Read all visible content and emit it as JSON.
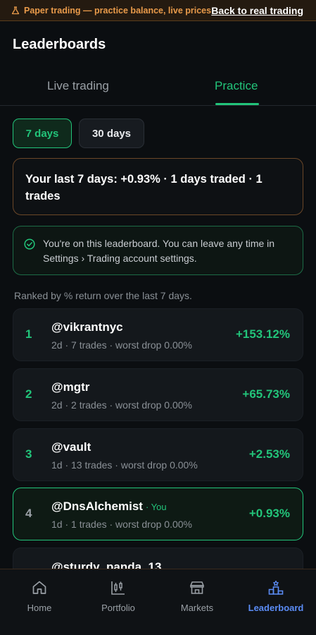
{
  "banner": {
    "text": "Paper trading — practice balance, live prices",
    "link": "Back to real trading"
  },
  "page_title": "Leaderboards",
  "tabs": [
    {
      "label": "Live trading",
      "active": false
    },
    {
      "label": "Practice",
      "active": true
    }
  ],
  "periods": [
    {
      "label": "7 days",
      "active": true
    },
    {
      "label": "30 days",
      "active": false
    }
  ],
  "summary": "Your last 7 days: +0.93% · 1 days traded · 1 trades",
  "notice": "You're on this leaderboard. You can leave any time in Settings › Trading account settings.",
  "ranked_note": "Ranked by % return over the last 7 days.",
  "entries": [
    {
      "rank": "1",
      "name": "@vikrantnyc",
      "meta": "2d · 7 trades · worst drop 0.00%",
      "ret": "+153.12%"
    },
    {
      "rank": "2",
      "name": "@mgtr",
      "meta": "2d · 2 trades · worst drop 0.00%",
      "ret": "+65.73%"
    },
    {
      "rank": "3",
      "name": "@vault",
      "meta": "1d · 13 trades · worst drop 0.00%",
      "ret": "+2.53%"
    },
    {
      "rank": "4",
      "name": "@DnsAlchemist",
      "you_tag": "· You",
      "meta": "1d · 1 trades · worst drop 0.00%",
      "ret": "+0.93%"
    },
    {
      "name": "@sturdy_panda_13"
    }
  ],
  "nav": [
    {
      "label": "Home",
      "icon": "home-icon"
    },
    {
      "label": "Portfolio",
      "icon": "candlestick-icon"
    },
    {
      "label": "Markets",
      "icon": "store-icon"
    },
    {
      "label": "Leaderboard",
      "icon": "podium-icon",
      "active": true
    }
  ],
  "colors": {
    "accent": "#22c47a",
    "warning": "#e89a4a",
    "nav_active": "#5b8cf5",
    "background": "#0b0e11"
  }
}
